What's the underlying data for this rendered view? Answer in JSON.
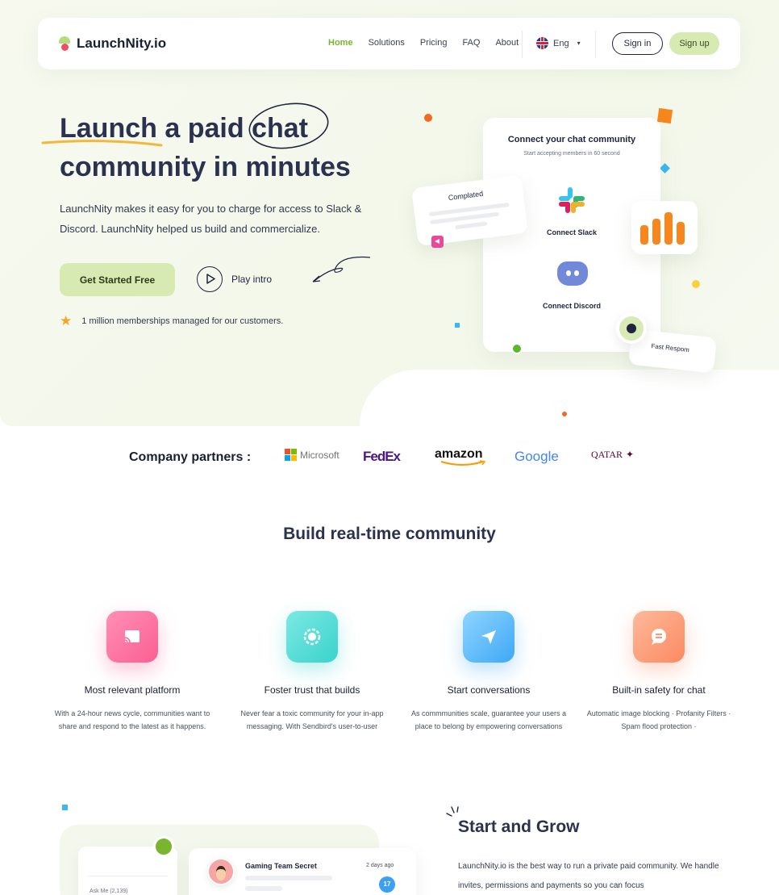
{
  "brand": {
    "name": "LaunchNity.io"
  },
  "nav": {
    "links": [
      {
        "label": "Home",
        "active": true
      },
      {
        "label": "Solutions"
      },
      {
        "label": "Pricing"
      },
      {
        "label": "FAQ"
      },
      {
        "label": "About"
      }
    ],
    "language": "Eng",
    "signin": "Sign in",
    "signup": "Sign up"
  },
  "hero": {
    "title_part1": "Launch a paid",
    "title_highlight": "chat",
    "title_part2": "community in minutes",
    "description": "LaunchNity makes it easy for you to charge for access to Slack & Discord. LaunchNity helped us build and commercialize.",
    "cta": "Get Started Free",
    "play": "Play intro",
    "stat": "1 million memberships managed for our customers."
  },
  "illustration": {
    "card_title": "Connect your chat community",
    "card_subtitle": "Start accepting members in 60 second",
    "slack_label": "Connect Slack",
    "discord_label": "Connect Discord",
    "completed": "Complated",
    "fast": "Fast Respom"
  },
  "partners": {
    "label": "Company partners :",
    "logos": [
      "Microsoft",
      "FedEx",
      "amazon",
      "Google",
      "QATAR"
    ]
  },
  "section": {
    "title": "Build real-time community"
  },
  "features": [
    {
      "icon": "cast-icon",
      "title": "Most relevant platform",
      "desc": "With a 24-hour news cycle, communities want to share and respond to the latest as it happens."
    },
    {
      "icon": "shield-badge-icon",
      "title": "Foster trust that builds",
      "desc": "Never fear a toxic community for your in-app messaging. With Sendbird's user-to-user"
    },
    {
      "icon": "send-icon",
      "title": "Start conversations",
      "desc": "As commmunities scale, guarantee your users a place to belong by empowering conversations"
    },
    {
      "icon": "chat-icon",
      "title": "Built-in safety for chat",
      "desc": "Automatic image blocking · Profanity Filters · Spam flood protection ·"
    }
  ],
  "bottom": {
    "ask": "Ask Me (2,139)",
    "chat_title": "Gaming Team Secret",
    "chat_time": "2 days ago",
    "unread": "17",
    "heading": "Start and Grow",
    "paragraph": "LaunchNity.io is the best way to run a private paid community. We handle invites, permissions and payments so you can focus"
  },
  "colors": {
    "accent_green": "#7ab52f",
    "button_green": "#d6eab1",
    "orange": "#f7871c",
    "text_dark": "#2d3150"
  }
}
